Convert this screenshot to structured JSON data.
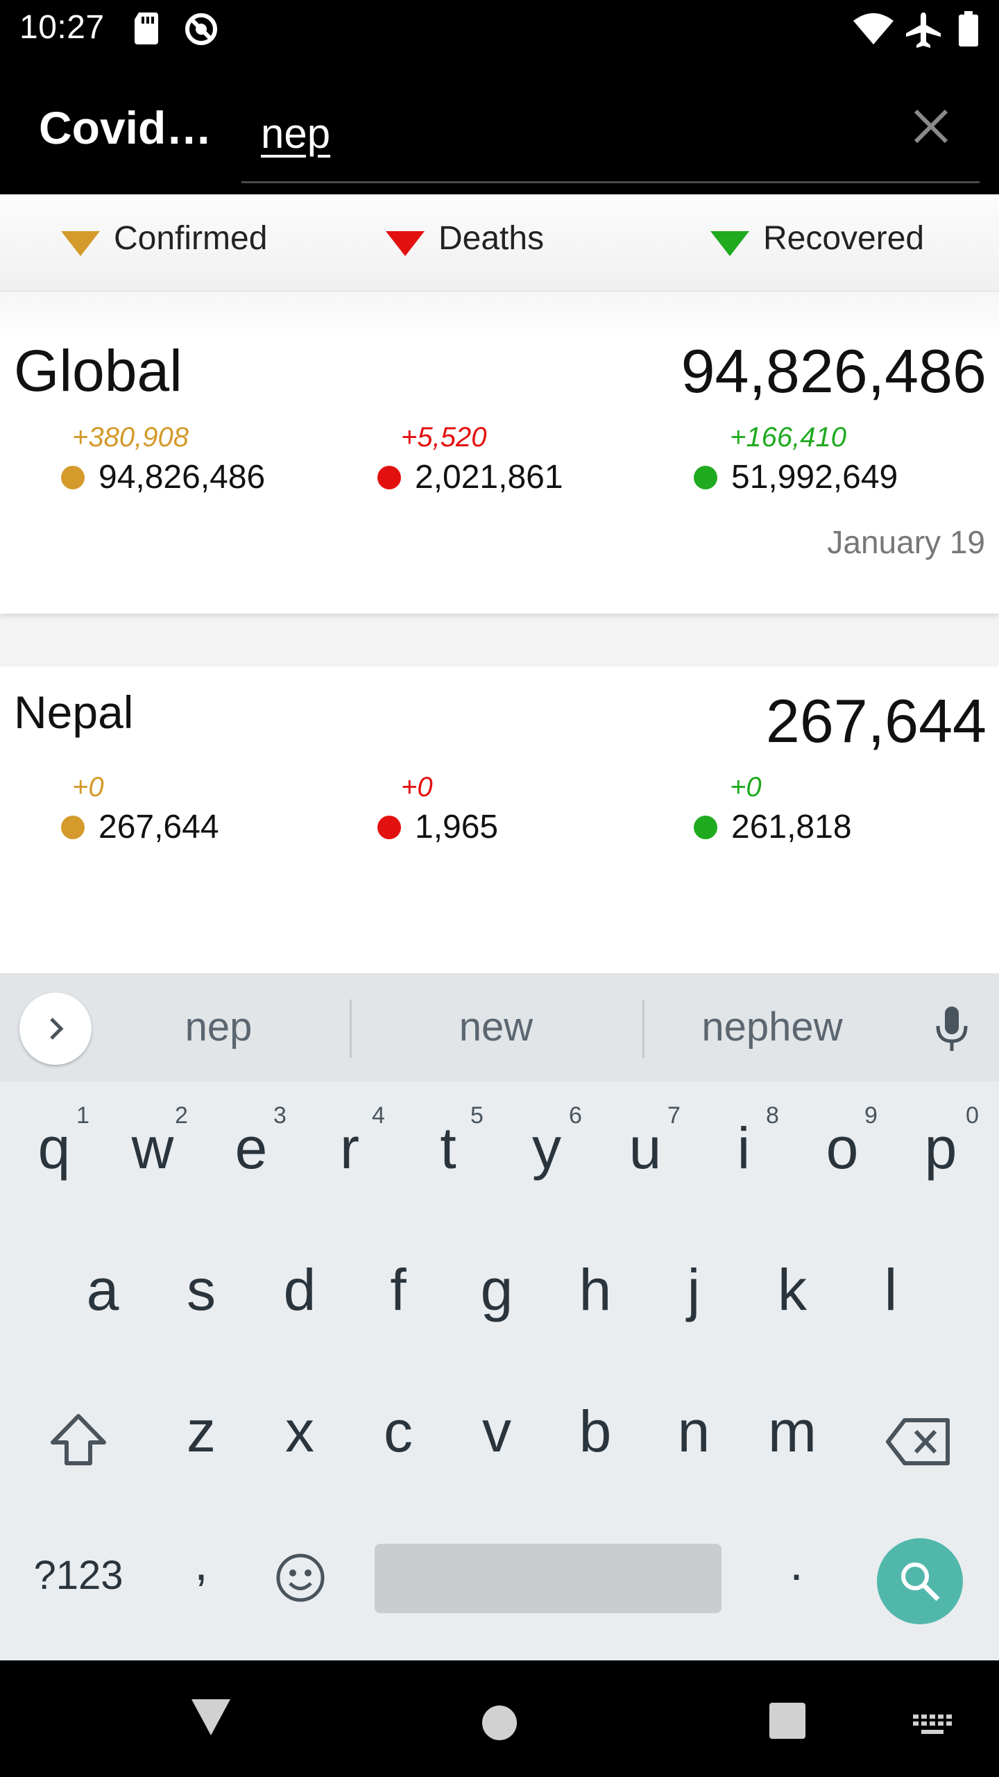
{
  "status_bar": {
    "time": "10:27",
    "icons": [
      "sd-card-icon",
      "sync-disabled-icon",
      "wifi-icon",
      "airplane-icon",
      "battery-icon"
    ]
  },
  "app_bar": {
    "title": "Covid…",
    "search_value": "nep",
    "close_icon": "close-icon"
  },
  "legend": {
    "items": [
      {
        "label": "Confirmed",
        "color": "#d49a2b"
      },
      {
        "label": "Deaths",
        "color": "#e31010"
      },
      {
        "label": "Recovered",
        "color": "#1faa1f"
      }
    ]
  },
  "cards": {
    "global": {
      "name": "Global",
      "total": "94,826,486",
      "confirmed_delta": "+380,908",
      "confirmed": "94,826,486",
      "deaths_delta": "+5,520",
      "deaths": "2,021,861",
      "recovered_delta": "+166,410",
      "recovered": "51,992,649",
      "date": "January 19"
    },
    "nepal": {
      "name": "Nepal",
      "total": "267,644",
      "confirmed_delta": "+0",
      "confirmed": "267,644",
      "deaths_delta": "+0",
      "deaths": "1,965",
      "recovered_delta": "+0",
      "recovered": "261,818"
    }
  },
  "colors": {
    "confirmed": "#d49a2b",
    "deaths": "#e31010",
    "recovered": "#1faa1f",
    "search_key": "#52b7ab"
  },
  "keyboard": {
    "suggestions": [
      "nep",
      "new",
      "nephew"
    ],
    "row1": [
      "q",
      "w",
      "e",
      "r",
      "t",
      "y",
      "u",
      "i",
      "o",
      "p"
    ],
    "row1_hints": [
      "1",
      "2",
      "3",
      "4",
      "5",
      "6",
      "7",
      "8",
      "9",
      "0"
    ],
    "row2": [
      "a",
      "s",
      "d",
      "f",
      "g",
      "h",
      "j",
      "k",
      "l"
    ],
    "row3": [
      "z",
      "x",
      "c",
      "v",
      "b",
      "n",
      "m"
    ],
    "symbols_label": "?123",
    "comma": ",",
    "period": "."
  }
}
